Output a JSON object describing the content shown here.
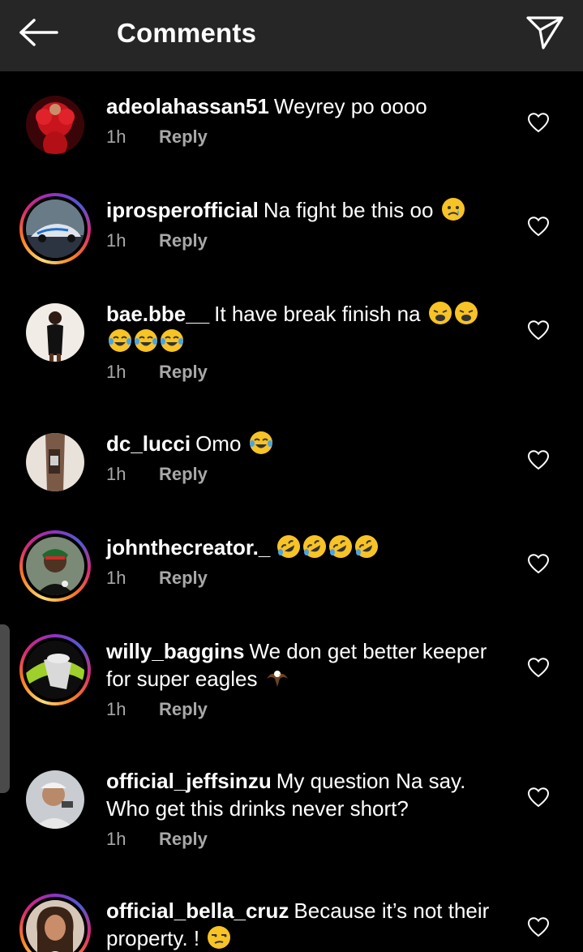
{
  "header": {
    "title": "Comments",
    "back_icon": "arrow-left-icon",
    "send_icon": "paper-plane-icon"
  },
  "colors": {
    "background": "#000000",
    "header": "#262626",
    "meta": "#a8a8a8",
    "emoji": "#f7c325"
  },
  "comments": [
    {
      "username": "adeolahassan51",
      "text": "Weyrey po oooo",
      "time": "1h",
      "reply": "Reply",
      "emojis": []
    },
    {
      "username": "iprosperofficial",
      "text": "Na fight be this oo",
      "time": "1h",
      "reply": "Reply",
      "emojis": [
        "sad-tear-emoji"
      ]
    },
    {
      "username": "bae.bbe__",
      "text": "It have break finish na",
      "time": "1h",
      "reply": "Reply",
      "emojis": [
        "weary-emoji",
        "weary-emoji",
        "laughing-tears-emoji",
        "laughing-tears-emoji",
        "laughing-tears-emoji"
      ]
    },
    {
      "username": "dc_lucci",
      "text": "Omo",
      "time": "1h",
      "reply": "Reply",
      "emojis": [
        "laughing-tears-emoji"
      ]
    },
    {
      "username": "johnthecreator._",
      "text": "",
      "time": "1h",
      "reply": "Reply",
      "emojis": [
        "rofl-emoji",
        "rofl-emoji",
        "rofl-emoji",
        "rofl-emoji"
      ]
    },
    {
      "username": "willy_baggins",
      "text": "We don get better keeper for super eagles",
      "time": "1h",
      "reply": "Reply",
      "emojis": [
        "eagle-emoji"
      ]
    },
    {
      "username": "official_jeffsinzu",
      "text": "My question Na say. Who get this drinks never short?",
      "time": "1h",
      "reply": "Reply",
      "emojis": []
    },
    {
      "username": "official_bella_cruz",
      "text": "Because it’s not their property. !",
      "time": "",
      "reply": "",
      "emojis": [
        "unamused-emoji"
      ]
    }
  ]
}
